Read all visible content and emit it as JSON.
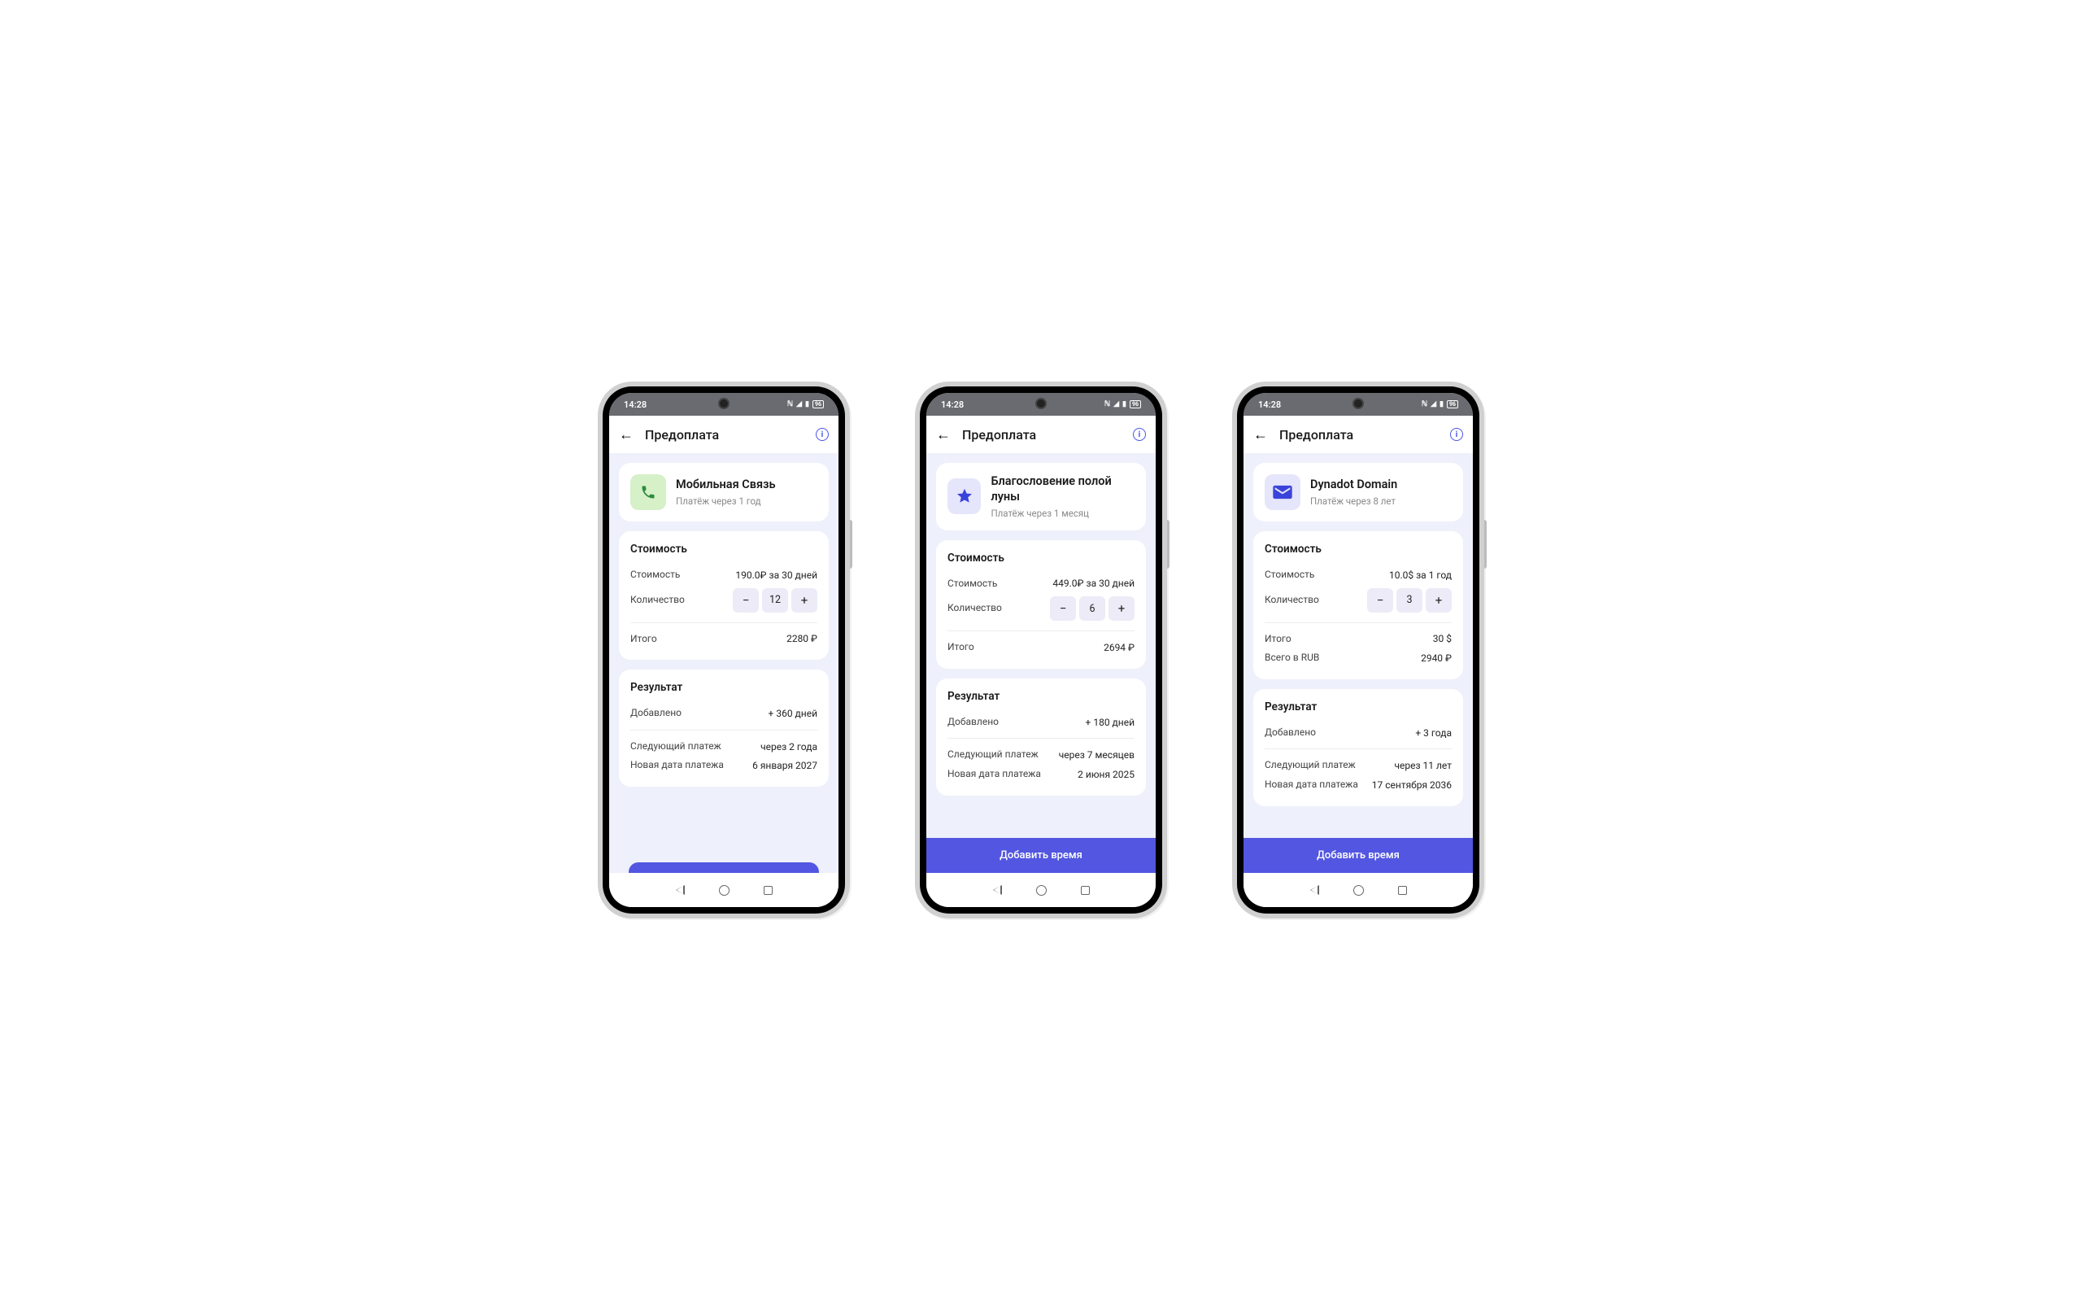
{
  "statusbar": {
    "time": "14:28",
    "battery": "96"
  },
  "appbar": {
    "title": "Предоплата"
  },
  "cta_label": "Добавить время",
  "labels": {
    "cost_section": "Стоимость",
    "cost_row": "Стоимость",
    "qty_row": "Количество",
    "total_row": "Итого",
    "total_rub_row": "Всего в RUB",
    "result_section": "Результат",
    "added_row": "Добавлено",
    "next_pay_row": "Следующий платеж",
    "new_date_row": "Новая дата платежа"
  },
  "phones": [
    {
      "icon": "phone",
      "icon_bg": "green",
      "title": "Мобильная Связь",
      "subtitle": "Платёж через 1 год",
      "cost_value": "190.0₽ за 30 дней",
      "qty": "12",
      "total": "2280 ₽",
      "total_rub": null,
      "added": "+ 360 дней",
      "next_pay": "через 2 года",
      "new_date": "6 января 2027",
      "cta_flush": false
    },
    {
      "icon": "star",
      "icon_bg": "purple",
      "title": "Благословение полой луны",
      "subtitle": "Платёж через 1 месяц",
      "cost_value": "449.0₽ за 30 дней",
      "qty": "6",
      "total": "2694 ₽",
      "total_rub": null,
      "added": "+ 180 дней",
      "next_pay": "через 7 месяцев",
      "new_date": "2 июня 2025",
      "cta_flush": true
    },
    {
      "icon": "mail",
      "icon_bg": "purple",
      "title": "Dynadot Domain",
      "subtitle": "Платёж через 8 лет",
      "cost_value": "10.0$ за 1 год",
      "qty": "3",
      "total": "30 $",
      "total_rub": "2940 ₽",
      "added": "+ 3 года",
      "next_pay": "через 11 лет",
      "new_date": "17 сентября 2036",
      "cta_flush": true
    }
  ]
}
